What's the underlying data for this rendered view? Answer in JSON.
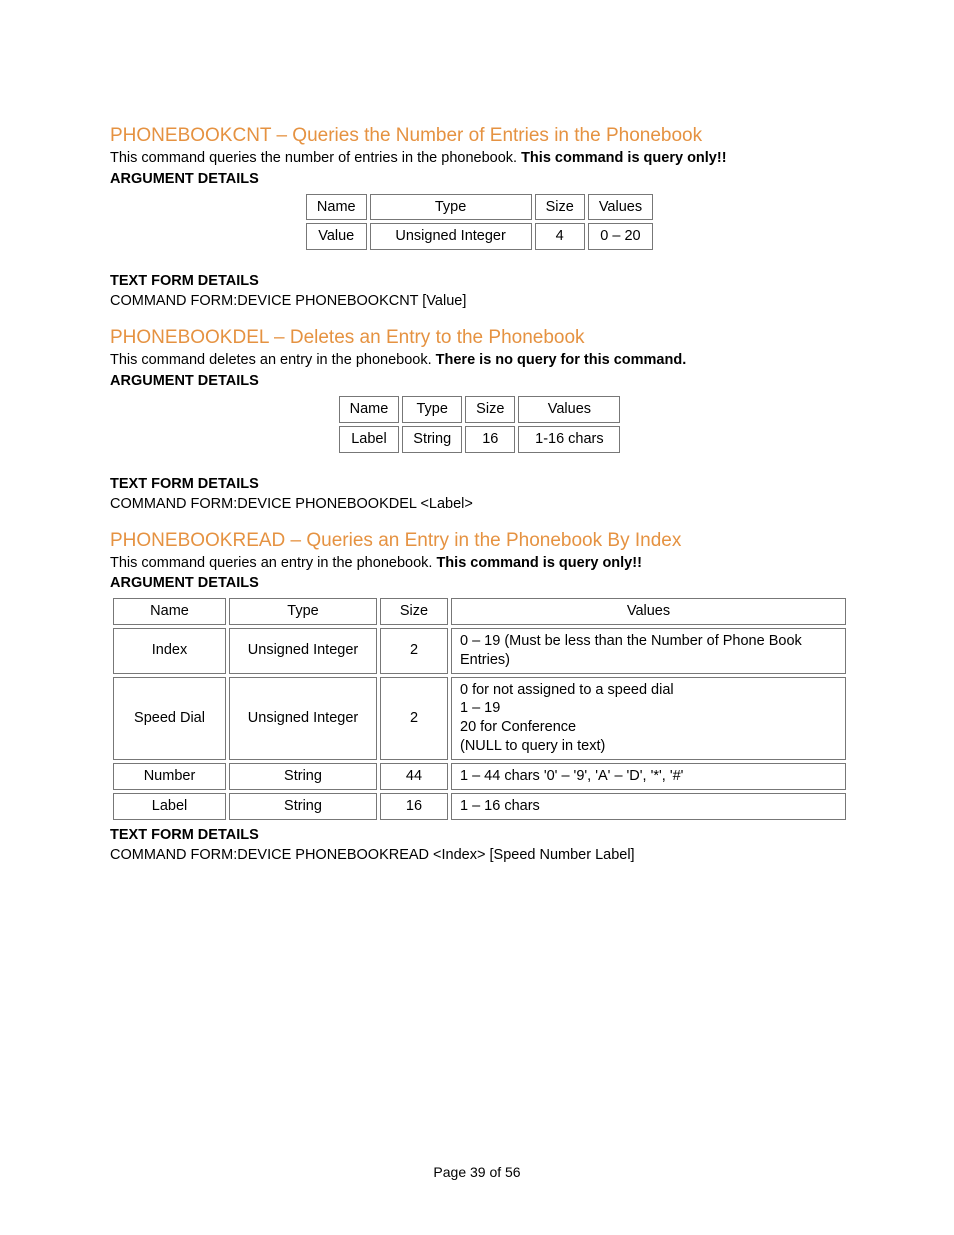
{
  "section1": {
    "heading": "PHONEBOOKCNT – Queries the Number of Entries in the Phonebook",
    "desc_plain": "This command queries the number of entries in the phonebook.  ",
    "desc_bold": "This command is query only!!",
    "arg_label": "ARGUMENT DETAILS",
    "table": {
      "h1": "Name",
      "h2": "Type",
      "h3": "Size",
      "h4": "Values",
      "r1c1": "Value",
      "r1c2": "Unsigned Integer",
      "r1c3": "4",
      "r1c4": "0 – 20"
    },
    "text_form_label": "TEXT FORM DETAILS",
    "text_form": "COMMAND FORM:DEVICE PHONEBOOKCNT [Value]"
  },
  "section2": {
    "heading": "PHONEBOOKDEL – Deletes an Entry to the Phonebook",
    "desc_plain": "This command deletes an entry in the phonebook. ",
    "desc_bold": "There is no query for this command.",
    "arg_label": "ARGUMENT DETAILS",
    "table": {
      "h1": "Name",
      "h2": "Type",
      "h3": "Size",
      "h4": "Values",
      "r1c1": "Label",
      "r1c2": "String",
      "r1c3": "16",
      "r1c4": "1-16 chars"
    },
    "text_form_label": "TEXT FORM DETAILS",
    "text_form": "COMMAND FORM:DEVICE PHONEBOOKDEL <Label>"
  },
  "section3": {
    "heading": "PHONEBOOKREAD – Queries an Entry in the Phonebook By Index",
    "desc_plain": "This command queries an entry in the phonebook.  ",
    "desc_bold": "This command is query only!!",
    "arg_label": "ARGUMENT DETAILS",
    "table": {
      "h1": "Name",
      "h2": "Type",
      "h3": "Size",
      "h4": "Values",
      "r1": {
        "c1": "Index",
        "c2": "Unsigned Integer",
        "c3": "2",
        "c4": "0 – 19 (Must be less than the Number of Phone Book Entries)"
      },
      "r2": {
        "c1": "Speed Dial",
        "c2": "Unsigned Integer",
        "c3": "2",
        "c4a": "0 for not assigned to a speed dial",
        "c4b": "1 – 19",
        "c4c": "20 for Conference",
        "c4d": "(NULL to query in text)"
      },
      "r3": {
        "c1": "Number",
        "c2": "String",
        "c3": "44",
        "c4": "1 – 44 chars '0' – '9', 'A' – 'D', '*', '#'"
      },
      "r4": {
        "c1": "Label",
        "c2": "String",
        "c3": "16",
        "c4": "1 – 16 chars"
      }
    },
    "text_form_label": "TEXT FORM DETAILS",
    "text_form": "COMMAND FORM:DEVICE PHONEBOOKREAD <Index> [Speed Number Label]"
  },
  "footer": "Page 39 of 56"
}
